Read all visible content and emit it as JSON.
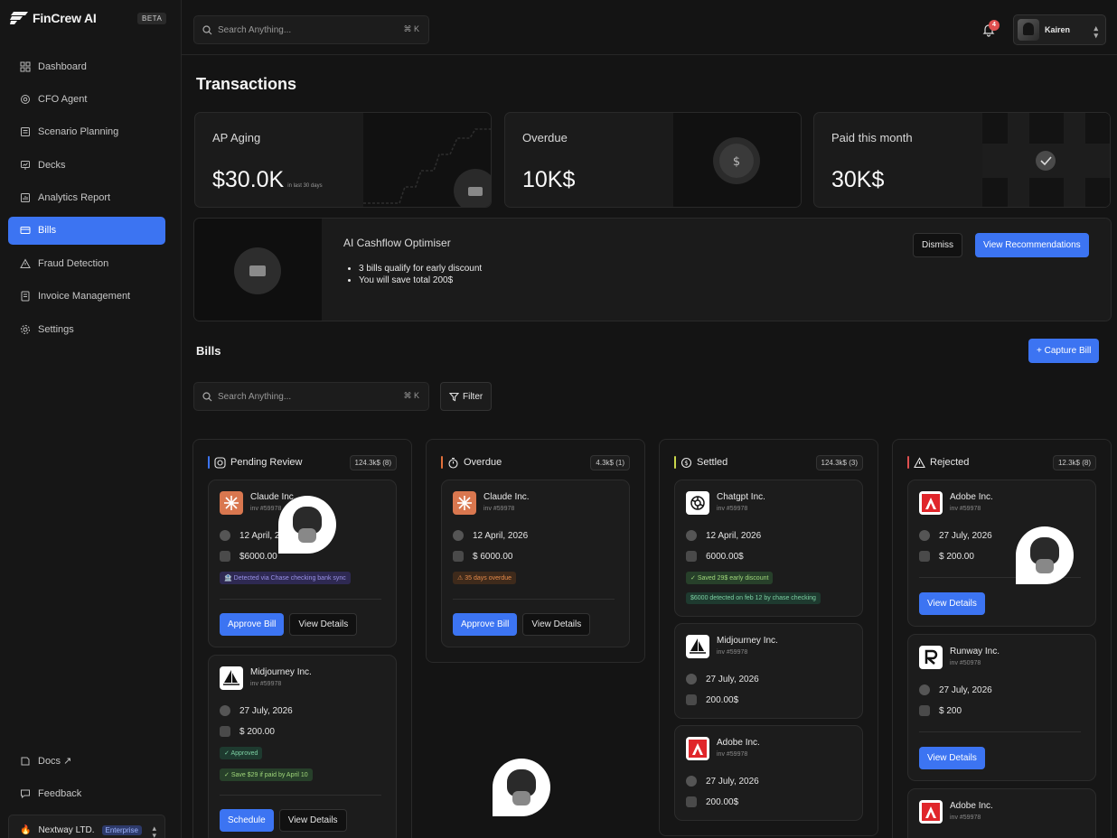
{
  "app": {
    "name": "FinCrew AI",
    "beta": "BETA"
  },
  "sidebar": {
    "items": [
      {
        "label": "Dashboard",
        "icon": "grid-icon"
      },
      {
        "label": "CFO Agent",
        "icon": "agent-icon"
      },
      {
        "label": "Scenario Planning",
        "icon": "doc-icon"
      },
      {
        "label": "Decks",
        "icon": "presentation-icon"
      },
      {
        "label": "Analytics Report",
        "icon": "chart-icon"
      },
      {
        "label": "Bills",
        "icon": "card-icon",
        "active": true
      },
      {
        "label": "Fraud Detection",
        "icon": "warning-icon"
      },
      {
        "label": "Invoice Management",
        "icon": "invoice-icon"
      },
      {
        "label": "Settings",
        "icon": "gear-icon"
      }
    ],
    "docs": "Docs ↗",
    "feedback": "Feedback",
    "org": {
      "name": "Nextway LTD.",
      "plan": "Enterprise"
    }
  },
  "topbar": {
    "search_placeholder": "Search Anything...",
    "shortcut": "⌘ K",
    "notifications": "4",
    "user": "Kairen"
  },
  "page": {
    "title": "Transactions"
  },
  "stats": [
    {
      "label": "AP Aging",
      "value": "$30.0K",
      "sub": "in last 30 days"
    },
    {
      "label": "Overdue",
      "value": "10K$"
    },
    {
      "label": "Paid this month",
      "value": "30K$"
    }
  ],
  "ai": {
    "title": "AI Cashflow Optimiser",
    "points": [
      "3 bills qualify for early discount",
      "You will save total 200$"
    ],
    "dismiss": "Dismiss",
    "view": "View Recommendations"
  },
  "bills": {
    "title": "Bills",
    "capture": "+ Capture Bill",
    "search_placeholder": "Search Anything...",
    "shortcut": "⌘ K",
    "filter": "Filter"
  },
  "columns": [
    {
      "title": "Pending Review",
      "count": "124.3k$ (8)",
      "cards": [
        {
          "name": "Claude Inc.",
          "inv": "inv #59978",
          "date": "12 April, 2026",
          "amount": "$6000.00",
          "tags": [
            "Detected via Chase checking bank sync"
          ],
          "primary": "Approve Bill",
          "secondary": "View Details"
        },
        {
          "name": "Midjourney Inc.",
          "inv": "inv #59978",
          "date": "27 July, 2026",
          "amount": "$ 200.00",
          "tags": [
            "Approved",
            "Save $29 if paid by April 10"
          ],
          "primary": "Schedule",
          "secondary": "View Details"
        }
      ]
    },
    {
      "title": "Overdue",
      "count": "4.3k$ (1)",
      "cards": [
        {
          "name": "Claude Inc.",
          "inv": "inv #59978",
          "date": "12 April, 2026",
          "amount": "$ 6000.00",
          "tags": [
            "35 days overdue"
          ],
          "primary": "Approve Bill",
          "secondary": "View Details"
        }
      ]
    },
    {
      "title": "Settled",
      "count": "124.3k$ (3)",
      "cards": [
        {
          "name": "Chatgpt Inc.",
          "inv": "inv #59978",
          "date": "12 April, 2026",
          "amount": "6000.00$",
          "tags": [
            "Saved 29$ early discount",
            "$6000 detected on feb 12 by chase checking"
          ]
        },
        {
          "name": "Midjourney Inc.",
          "inv": "inv #59978",
          "date": "27 July, 2026",
          "amount": "200.00$"
        },
        {
          "name": "Adobe Inc.",
          "inv": "inv #59978",
          "date": "27 July, 2026",
          "amount": "200.00$"
        }
      ]
    },
    {
      "title": "Rejected",
      "count": "12.3k$ (8)",
      "cards": [
        {
          "name": "Adobe Inc.",
          "inv": "inv #59978",
          "date": "27 July, 2026",
          "amount": "$ 200.00",
          "primary": "View Details"
        },
        {
          "name": "Runway Inc.",
          "inv": "inv #50978",
          "date": "27 July, 2026",
          "amount": "$ 200",
          "primary": "View Details"
        },
        {
          "name": "Adobe Inc.",
          "inv": "inv #59978"
        }
      ]
    }
  ],
  "colors": {
    "accent": "#3c74f2",
    "pending": "#3c74f2",
    "overdue": "#e3703a",
    "settled": "#c9d64a",
    "rejected": "#e05050"
  }
}
